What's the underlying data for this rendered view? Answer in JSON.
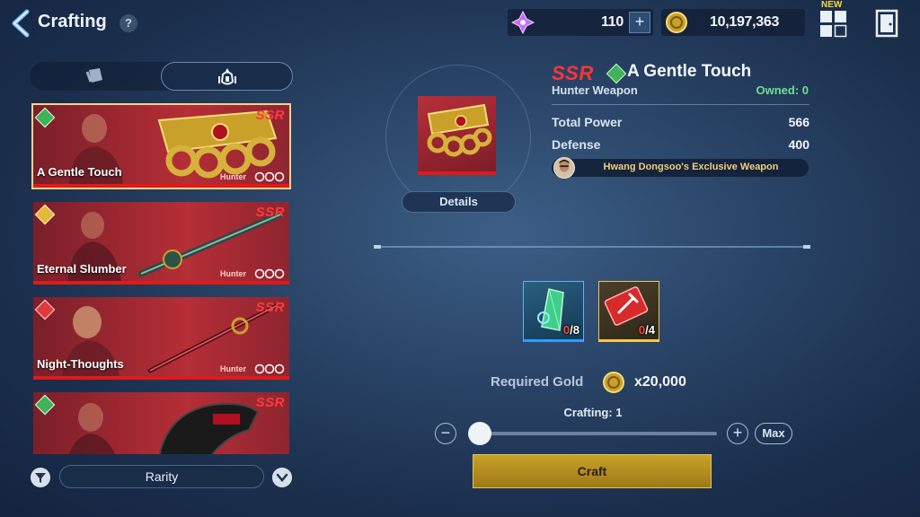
{
  "header": {
    "title": "Crafting",
    "help": "?",
    "gem_amount": "110",
    "gold_amount": "10,197,363",
    "plus": "+",
    "new_badge": "NEW"
  },
  "tabs": [
    {
      "icon": "scroll-icon",
      "active": false
    },
    {
      "icon": "hunter-icon",
      "active": true
    }
  ],
  "items": [
    {
      "name": "A Gentle Touch",
      "rarity": "SSR",
      "tag": "Hunter",
      "element_color": "#3fb25a",
      "selected": true
    },
    {
      "name": "Eternal Slumber",
      "rarity": "SSR",
      "tag": "Hunter",
      "element_color": "#e6b93a",
      "selected": false
    },
    {
      "name": "Night-Thoughts",
      "rarity": "SSR",
      "tag": "Hunter",
      "element_color": "#e03a3a",
      "selected": false
    },
    {
      "name": "",
      "rarity": "SSR",
      "tag": "",
      "element_color": "#3fb25a",
      "selected": false
    }
  ],
  "filter": {
    "sort_label": "Rarity"
  },
  "preview": {
    "details_label": "Details"
  },
  "info": {
    "rarity": "SSR",
    "name": "A Gentle Touch",
    "type": "Hunter Weapon",
    "owned": "Owned: 0",
    "stats": [
      {
        "label": "Total Power",
        "value": "566"
      },
      {
        "label": "Defense",
        "value": "400"
      }
    ],
    "exclusive": "Hwang Dongsoo's Exclusive Weapon"
  },
  "materials": [
    {
      "icon": "green-crystal-icon",
      "have": "0",
      "need": "/8"
    },
    {
      "icon": "red-ticket-icon",
      "have": "0",
      "need": "/4"
    }
  ],
  "craft": {
    "required_gold_label": "Required Gold",
    "required_gold_amount": "x20,000",
    "crafting_count": "Crafting: 1",
    "max_label": "Max",
    "minus": "−",
    "plus": "+",
    "craft_label": "Craft",
    "quantity": 1
  },
  "colors": {
    "accent_red": "#ff3535",
    "owned_green": "#6ee08f",
    "gold_button": "#c9a128"
  }
}
